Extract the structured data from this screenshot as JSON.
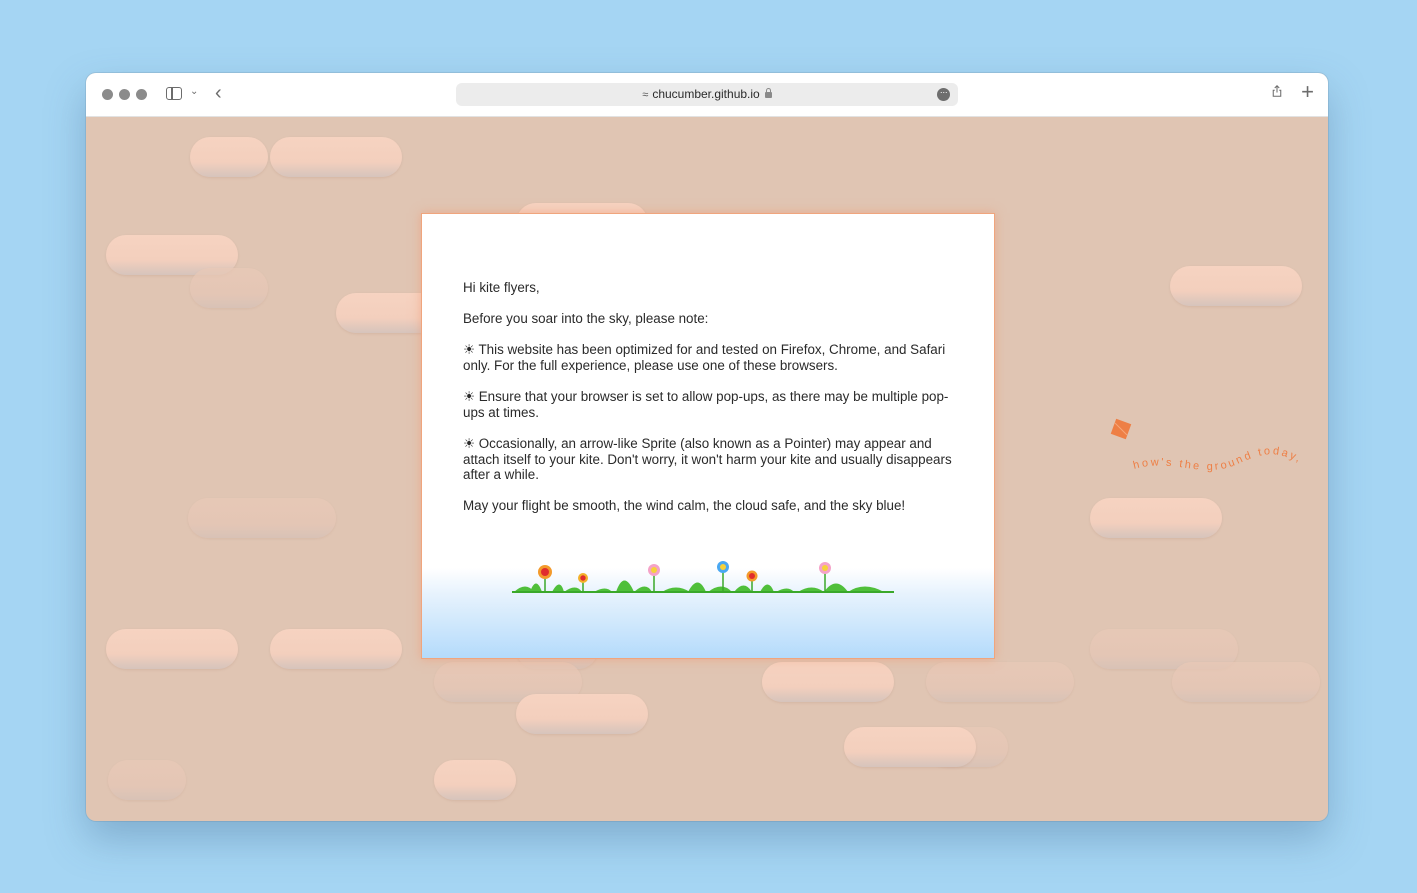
{
  "browser": {
    "url": "chucumber.github.io"
  },
  "notice": {
    "greeting": "Hi kite flyers,",
    "intro": "Before you soar into the sky, please note:",
    "bullets": [
      "☀ This website has been optimized for and tested on Firefox, Chrome, and Safari only. For the full experience, please use one of these browsers.",
      "☀ Ensure that your browser is set to allow pop-ups, as there may be multiple pop-ups at times.",
      "☀ Occasionally, an arrow-like Sprite (also known as a Pointer) may appear and attach itself to your kite. Don't worry, it won't harm your kite and usually disappears after a while."
    ],
    "closing": "May your flight be smooth, the wind calm, the cloud safe, and the sky blue!"
  },
  "kite": {
    "caption": "how's the ground today,",
    "color": "#ee7f45"
  },
  "colors": {
    "desktop": "#a5d5f3",
    "page_background": "#e0c5b3",
    "cloud": "#f6d3c1",
    "notice_border": "#f0a57d"
  },
  "icons": [
    "sidebar-icon",
    "chevron-down-icon",
    "back-icon",
    "site-icon",
    "lock-icon",
    "more-icon",
    "share-icon",
    "plus-icon",
    "kite-icon",
    "flower-icon"
  ]
}
